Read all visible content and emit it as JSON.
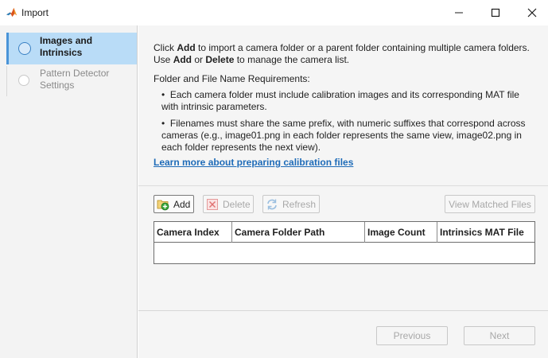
{
  "window": {
    "title": "Import",
    "icon": "matlab-logo-icon"
  },
  "nav": {
    "items": [
      {
        "label": "Images and Intrinsics",
        "state": "active"
      },
      {
        "label": "Pattern Detector Settings",
        "state": "inactive"
      }
    ]
  },
  "instructions": {
    "line1_a": "Click ",
    "line1_add": "Add",
    "line1_b": " to import a camera folder or a parent folder containing multiple camera folders.",
    "line2_a": "Use ",
    "line2_add": "Add",
    "line2_or": " or ",
    "line2_delete": "Delete",
    "line2_b": " to manage the camera list.",
    "requirements_heading": "Folder and File Name Requirements:",
    "bullets": [
      "Each camera folder must include calibration images and its corresponding MAT file with intrinsic parameters.",
      "Filenames must share the same prefix, with numeric suffixes that correspond across cameras (e.g., image01.png in each folder represents the same view, image02.png in each folder represents the next view)."
    ],
    "learn_more_link": "Learn more about preparing calibration files"
  },
  "toolbar": {
    "add_label": "Add",
    "delete_label": "Delete",
    "refresh_label": "Refresh",
    "view_matched_label": "View Matched Files"
  },
  "table": {
    "columns": [
      "Camera Index",
      "Camera Folder Path",
      "Image Count",
      "Intrinsics MAT File"
    ],
    "rows": []
  },
  "footer": {
    "previous_label": "Previous",
    "next_label": "Next"
  },
  "colors": {
    "nav_active_bg": "#b9dcf7",
    "nav_active_accent": "#4a94d8",
    "link": "#1e6bb8"
  }
}
